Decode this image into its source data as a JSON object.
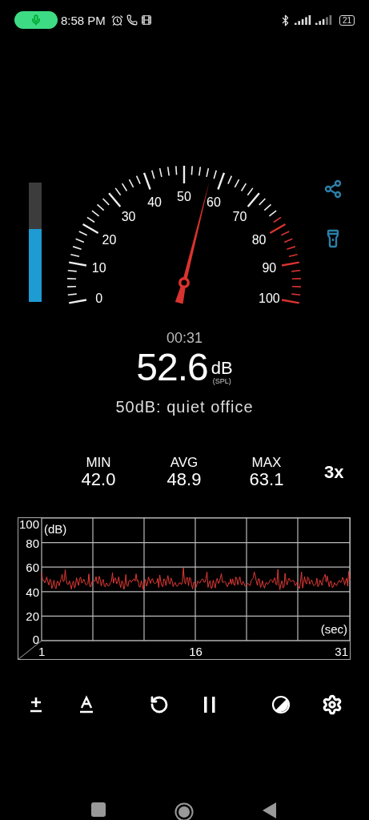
{
  "status_bar": {
    "time": "8:58 PM",
    "battery": "21"
  },
  "level_bar": {
    "level": 0.61
  },
  "gauge": {
    "labels": [
      "0",
      "10",
      "20",
      "30",
      "40",
      "50",
      "60",
      "70",
      "80",
      "90",
      "100"
    ]
  },
  "timer": "00:31",
  "reading": {
    "value": "52.6",
    "unit": "dB",
    "unit_note": "(SPL)"
  },
  "description": "50dB: quiet office",
  "stats": [
    {
      "label": "MIN",
      "value": "42.0"
    },
    {
      "label": "AVG",
      "value": "48.9"
    },
    {
      "label": "MAX",
      "value": "63.1"
    }
  ],
  "zoom": "3x",
  "graph": {
    "y_ticks": [
      "100",
      "80",
      "60",
      "40",
      "20",
      "0"
    ],
    "y_unit": "(dB)",
    "x_unit": "(sec)",
    "x_ticks": [
      "1",
      "16",
      "31"
    ]
  }
}
